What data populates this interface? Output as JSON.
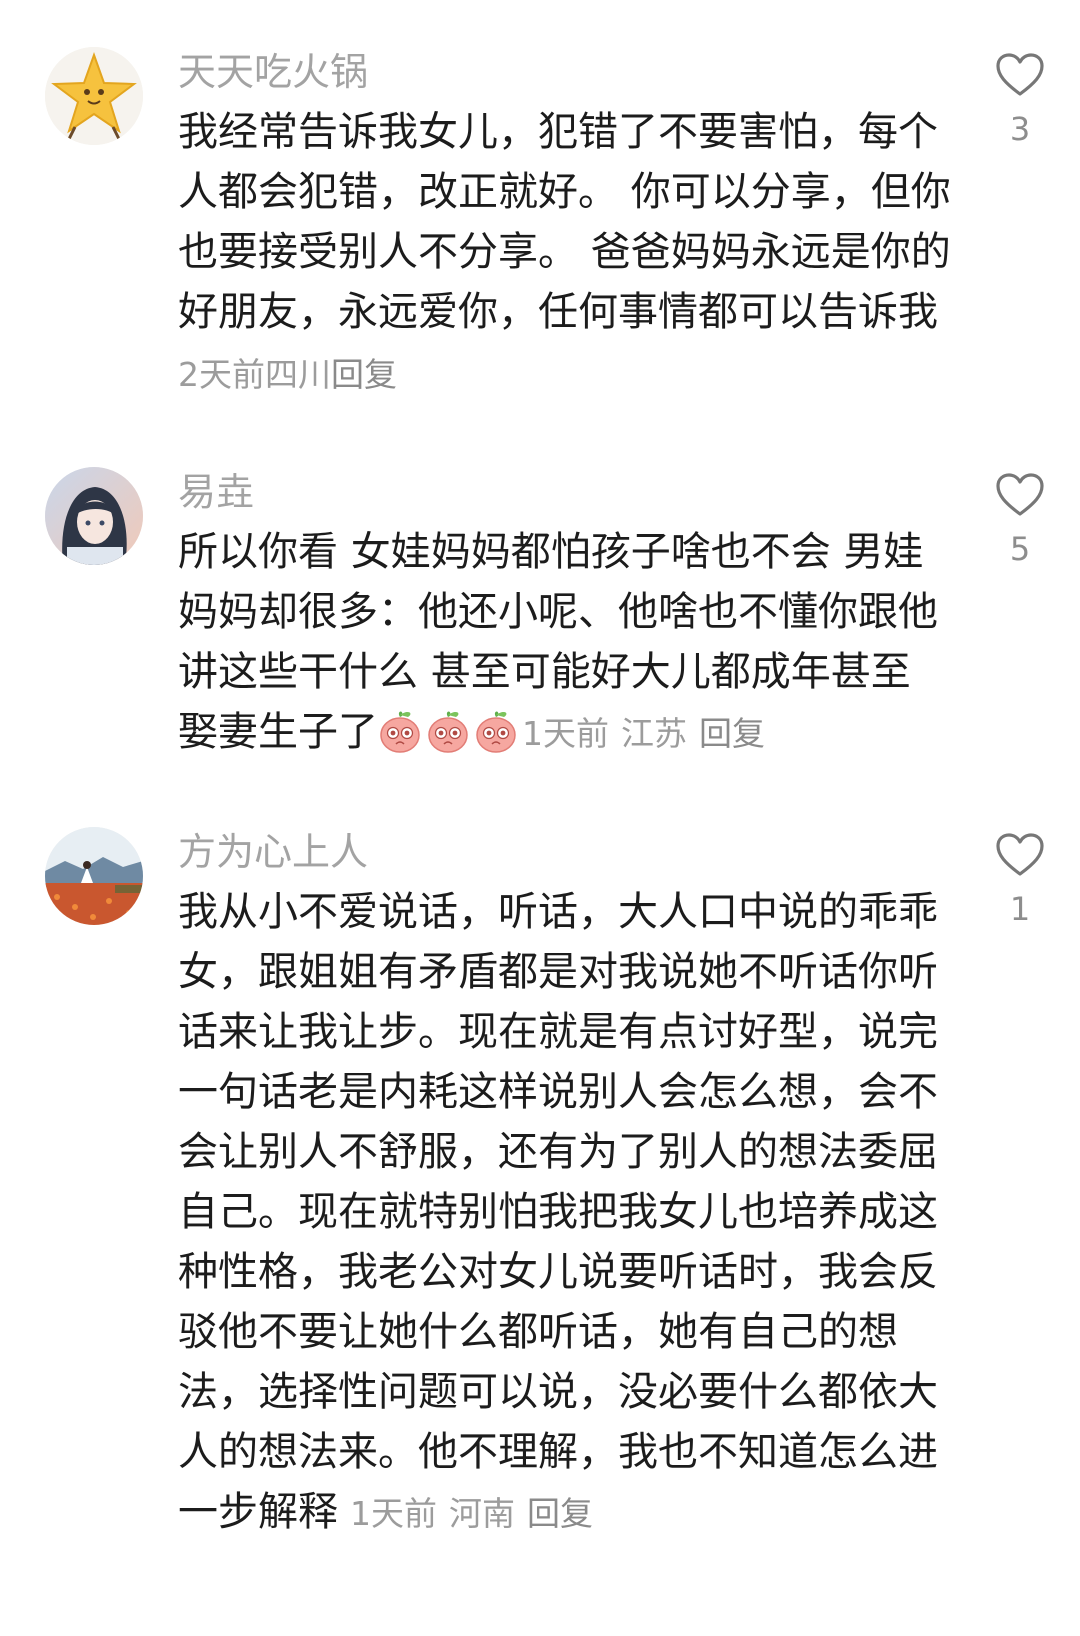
{
  "comments": [
    {
      "username": "天天吃火锅",
      "lines": [
        "我经常告诉我女儿，犯错了不要害怕，每个",
        "人都会犯错，改正就好。 你可以分享，但你",
        "也要接受别人不分享。 爸爸妈妈永远是你的",
        "好朋友，永远爱你，任何事情都可以告诉我"
      ],
      "time": "2天前",
      "location": "四川",
      "reply_label": "回复",
      "likes": "3",
      "avatar_icon": "star-character-icon"
    },
    {
      "username": "易垚",
      "lines": [
        "所以你看  女娃妈妈都怕孩子啥也不会   男娃",
        "妈妈却很多：他还小呢、他啥也不懂你跟他",
        "讲这些干什么   甚至可能好大儿都成年甚至",
        "娶妻生子了"
      ],
      "emoji_count": 3,
      "emoji_icon": "peach-face-emoji-icon",
      "time": "1天前",
      "location": "江苏",
      "reply_label": "回复",
      "likes": "5",
      "avatar_icon": "anime-girl-icon"
    },
    {
      "username": "方为心上人",
      "lines": [
        "我从小不爱说话，听话，大人口中说的乖乖",
        "女，跟姐姐有矛盾都是对我说她不听话你听",
        "话来让我让步。现在就是有点讨好型，说完",
        "一句话老是内耗这样说别人会怎么想，会不",
        "会让别人不舒服，还有为了别人的想法委屈",
        "自己。现在就特别怕我把我女儿也培养成这",
        "种性格，我老公对女儿说要听话时，我会反",
        "驳他不要让她什么都听话，她有自己的想",
        "法，选择性问题可以说，没必要什么都依大",
        "人的想法来。他不理解，我也不知道怎么进",
        "一步解释"
      ],
      "time": "1天前",
      "location": "河南",
      "reply_label": "回复",
      "likes": "1",
      "avatar_icon": "flower-field-photo-icon"
    }
  ],
  "icons": {
    "like": "heart-outline-icon"
  }
}
